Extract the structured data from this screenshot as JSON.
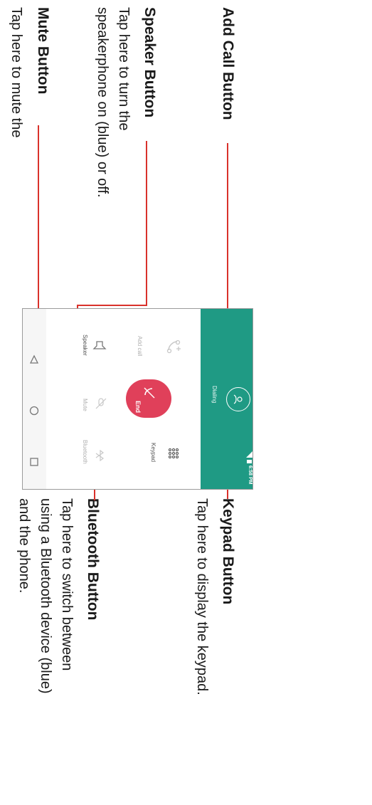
{
  "annotations": {
    "add_call": {
      "title": "Add Call Button"
    },
    "speaker": {
      "title": "Speaker Button",
      "desc_line1": "Tap here to turn the",
      "desc_line2": "speakerphone on (blue) or off."
    },
    "mute": {
      "title": "Mute Button",
      "desc_line1": "Tap here to mute the"
    },
    "keypad": {
      "title": "Keypad Button",
      "desc_line1": "Tap here to display the keypad."
    },
    "bluetooth": {
      "title": "Bluetooth Button",
      "desc_line1": "Tap here to switch between",
      "desc_line2": "using a Bluetooth device (blue)",
      "desc_line3": "and the phone."
    }
  },
  "phone": {
    "status_time": "6:58 PM",
    "call_status": "Dialing",
    "buttons": {
      "add_call": "Add call",
      "speaker": "Speaker",
      "end": "End",
      "mute": "Mute",
      "keypad": "Keypad",
      "bluetooth": "Bluetooth"
    },
    "nav": [
      "back-icon",
      "home-icon",
      "recents-icon"
    ],
    "colors": {
      "header": "#1f9a84",
      "end_button": "#e0405a",
      "callout_line": "#d9312b"
    }
  }
}
